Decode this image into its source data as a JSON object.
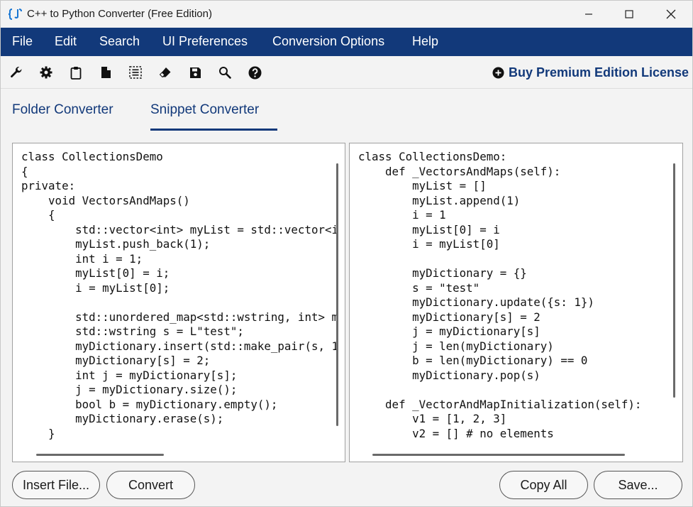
{
  "window": {
    "title": "C++ to Python Converter (Free Edition)"
  },
  "menu": {
    "items": [
      "File",
      "Edit",
      "Search",
      "UI Preferences",
      "Conversion Options",
      "Help"
    ]
  },
  "toolbar": {
    "icons": [
      "wrench-icon",
      "gear-icon",
      "clipboard-icon",
      "document-icon",
      "select-all-icon",
      "eraser-icon",
      "save-icon",
      "magnifier-icon",
      "help-icon"
    ],
    "premium_label": "Buy Premium Edition License"
  },
  "tabs": [
    {
      "label": "Folder Converter",
      "selected": false
    },
    {
      "label": "Snippet Converter",
      "selected": true
    }
  ],
  "source_pane": {
    "code": "class CollectionsDemo\n{\nprivate:\n    void VectorsAndMaps()\n    {\n        std::vector<int> myList = std::vector<i\n        myList.push_back(1);\n        int i = 1;\n        myList[0] = i;\n        i = myList[0];\n\n        std::unordered_map<std::wstring, int> m\n        std::wstring s = L\"test\";\n        myDictionary.insert(std::make_pair(s, 1\n        myDictionary[s] = 2;\n        int j = myDictionary[s];\n        j = myDictionary.size();\n        bool b = myDictionary.empty();\n        myDictionary.erase(s);\n    }"
  },
  "output_pane": {
    "code": "class CollectionsDemo:\n    def _VectorsAndMaps(self):\n        myList = []\n        myList.append(1)\n        i = 1\n        myList[0] = i\n        i = myList[0]\n\n        myDictionary = {}\n        s = \"test\"\n        myDictionary.update({s: 1})\n        myDictionary[s] = 2\n        j = myDictionary[s]\n        j = len(myDictionary)\n        b = len(myDictionary) == 0\n        myDictionary.pop(s)\n\n    def _VectorAndMapInitialization(self):\n        v1 = [1, 2, 3]\n        v2 = [] # no elements"
  },
  "buttons": {
    "insert_file": "Insert File...",
    "convert": "Convert",
    "copy_all": "Copy All",
    "save": "Save..."
  },
  "colors": {
    "brand": "#12397a",
    "menubar_text": "#ffffff"
  }
}
